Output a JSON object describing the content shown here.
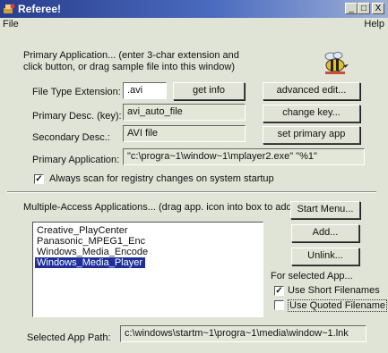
{
  "window": {
    "title": "Referee!",
    "buttons": {
      "minimize": "_",
      "maximize": "□",
      "close": "X"
    }
  },
  "menu": {
    "file": "File",
    "help": "Help"
  },
  "primary": {
    "intro_line1": "Primary Application... (enter 3-char extension and",
    "intro_line2": "click button, or drag sample file into this window)",
    "file_type_label": "File Type Extension:",
    "file_type_value": ".avi",
    "get_info_button": "get info",
    "advanced_edit_button": "advanced edit...",
    "primary_desc_label": "Primary Desc. (key):",
    "primary_desc_value": "avi_auto_file",
    "change_key_button": "change key...",
    "secondary_desc_label": "Secondary Desc.:",
    "secondary_desc_value": "AVI file",
    "set_primary_button": "set primary app",
    "primary_app_label": "Primary Application:",
    "primary_app_value": "\"c:\\progra~1\\window~1\\mplayer2.exe\" \"%1\"",
    "always_scan_label": "Always scan for registry changes on system startup",
    "always_scan_checked": true
  },
  "multi": {
    "header": "Multiple-Access Applications... (drag app. icon into box to add)",
    "start_menu_button": "Start Menu...",
    "add_button": "Add...",
    "unlink_button": "Unlink...",
    "apps": [
      {
        "name": "Creative_PlayCenter",
        "selected": false
      },
      {
        "name": "Panasonic_MPEG1_Enc",
        "selected": false
      },
      {
        "name": "Windows_Media_Encode",
        "selected": false
      },
      {
        "name": "Windows_Media_Player",
        "selected": true
      }
    ],
    "for_selected_label": "For selected App...",
    "use_short_label": "Use Short Filenames",
    "use_short_checked": true,
    "use_quoted_label": "Use Quoted Filename",
    "use_quoted_checked": false,
    "selected_path_label": "Selected App Path:",
    "selected_path_value": "c:\\windows\\startm~1\\progra~1\\media\\window~1.lnk"
  },
  "colors": {
    "titlebar_start": "#2a3d8c",
    "window_bg": "#dfe4d6",
    "selection": "#1e2f9a"
  }
}
